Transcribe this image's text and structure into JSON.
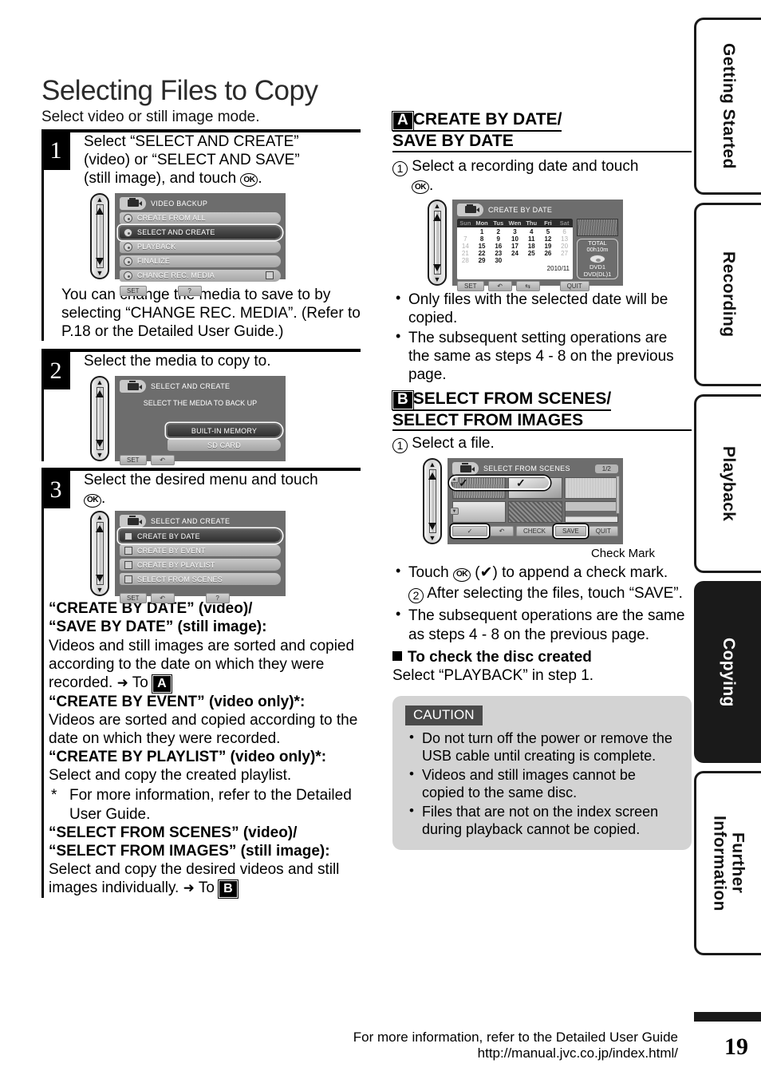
{
  "page": {
    "title": "Selecting Files to Copy",
    "subtitle": "Select video or still image mode.",
    "number": "19"
  },
  "footer": {
    "line1": "For more information, refer to the Detailed User Guide",
    "line2": "http://manual.jvc.co.jp/index.html/"
  },
  "side_tabs": [
    {
      "label": "Getting Started",
      "active": false
    },
    {
      "label": "Recording",
      "active": false
    },
    {
      "label": "Playback",
      "active": false
    },
    {
      "label": "Copying",
      "active": true
    },
    {
      "label": "Further\nInformation",
      "active": false
    }
  ],
  "steps": [
    {
      "number": "1",
      "text_a": "Select “SELECT AND CREATE”",
      "text_b": "(video) or “SELECT AND SAVE”",
      "text_c": "(still image), and touch ",
      "ok": "OK",
      "text_d": ".",
      "note": "You can change the media to save to by selecting “CHANGE REC. MEDIA”. (Refer to P.18 or the Detailed User Guide.)"
    },
    {
      "number": "2",
      "text_a": "Select the media to copy to."
    },
    {
      "number": "3",
      "text_a": "Select the desired menu and touch ",
      "ok": "OK",
      "text_d": "."
    }
  ],
  "screen_step1": {
    "title": "VIDEO BACKUP",
    "rows": [
      {
        "label": "CREATE FROM ALL",
        "icon": "disc-icon",
        "selected": false
      },
      {
        "label": "SELECT AND CREATE",
        "icon": "disc-icon",
        "selected": true
      },
      {
        "label": "PLAYBACK",
        "icon": "disc-icon",
        "selected": false
      },
      {
        "label": "FINALIZE",
        "icon": "disc-icon",
        "selected": false
      },
      {
        "label": "CHANGE REC. MEDIA",
        "icon": "disc-icon",
        "selected": false
      }
    ],
    "buttons": [
      {
        "label": "SET"
      },
      {
        "label": "?"
      }
    ]
  },
  "screen_step2": {
    "title": "SELECT AND CREATE",
    "prompt": "SELECT THE MEDIA TO BACK UP",
    "options": [
      {
        "label": "BUILT-IN MEMORY",
        "selected": true
      },
      {
        "label": "SD CARD",
        "selected": false
      }
    ],
    "buttons": [
      {
        "label": "SET"
      },
      {
        "label": "back-arrow"
      }
    ]
  },
  "screen_step3": {
    "title": "SELECT AND CREATE",
    "rows": [
      {
        "label": "CREATE BY DATE",
        "selected": true
      },
      {
        "label": "CREATE BY EVENT",
        "selected": false
      },
      {
        "label": "CREATE BY PLAYLIST",
        "selected": false
      },
      {
        "label": "SELECT FROM SCENES",
        "selected": false
      }
    ],
    "buttons": [
      {
        "label": "SET"
      },
      {
        "label": "back-arrow"
      },
      {
        "label": "?"
      }
    ]
  },
  "menu_descriptions": [
    {
      "heading_a": "“CREATE BY DATE” (video)/",
      "heading_b": "“SAVE BY DATE” (still image):",
      "body": "Videos and still images are sorted and copied according to the date on which they were recorded.",
      "ref_to": "To",
      "ref_badge": "A"
    },
    {
      "heading_a": "“CREATE BY EVENT” (video only)*:",
      "body": "Videos are sorted and copied according to the date on which they were recorded."
    },
    {
      "heading_a": "“CREATE BY PLAYLIST” (video only)*:",
      "body": "Select and copy the created playlist."
    }
  ],
  "footnote": {
    "marker": "*",
    "text": "For more information, refer to the Detailed User Guide."
  },
  "menu_descriptions_2": {
    "heading_a": "“SELECT FROM SCENES” (video)/",
    "heading_b": "“SELECT FROM IMAGES” (still image):",
    "body": "Select and copy the desired videos and still images individually.",
    "ref_to": "To",
    "ref_badge": "B"
  },
  "section_a": {
    "badge": "A",
    "heading_1": "CREATE BY DATE/",
    "heading_2": "SAVE BY DATE",
    "step1_num": "1",
    "step1_text_a": "Select a recording date and touch",
    "step1_ok": "OK",
    "step1_text_b": ".",
    "bullets": [
      "Only files with the selected date will be copied.",
      "The subsequent setting operations are the same as steps 4 - 8 on the previous page."
    ]
  },
  "screen_calendar": {
    "title": "CREATE BY DATE",
    "dow": [
      "Sun",
      "Mon",
      "Tus",
      "Wen",
      "Thu",
      "Fri",
      "Sat"
    ],
    "weeks": [
      [
        "",
        "1",
        "2",
        "3",
        "4",
        "5",
        "6"
      ],
      [
        "7",
        "8",
        "9",
        "10",
        "11",
        "12",
        "13"
      ],
      [
        "14",
        "15",
        "16",
        "17",
        "18",
        "19",
        "20"
      ],
      [
        "21",
        "22",
        "23",
        "24",
        "25",
        "26",
        "27"
      ],
      [
        "28",
        "29",
        "30",
        "",
        "",
        "",
        ""
      ]
    ],
    "dim_cells": [
      "6",
      "13",
      "20",
      "27",
      "7",
      "14",
      "21",
      "28",
      "1",
      "8",
      "15"
    ],
    "year_month": "2010/11",
    "total_label": "TOTAL",
    "total_time": "00h10m",
    "disc_label_1": "DVD1",
    "disc_label_2": "DVD(DL)1",
    "buttons": [
      {
        "label": "SET"
      },
      {
        "label": "back-arrow"
      },
      {
        "label": "media-switch"
      },
      {
        "label": "QUIT"
      }
    ]
  },
  "section_b": {
    "badge": "B",
    "heading_1": "SELECT FROM SCENES/",
    "heading_2": "SELECT FROM IMAGES",
    "step1_num": "1",
    "step1_text": "Select a file.",
    "check_mark_caption": "Check Mark",
    "bullet_touch_a": "Touch ",
    "bullet_touch_ok": "OK",
    "bullet_touch_b": " (✔) to append a check mark.",
    "step2_num": "2",
    "step2_text": "After selecting the files, touch “SAVE”.",
    "bullet_subsequent": "The subsequent operations are the same as steps 4 - 8 on the previous page.",
    "check_disc_heading": "To check the disc created",
    "check_disc_body": "Select “PLAYBACK” in step 1."
  },
  "screen_scenes": {
    "title": "SELECT FROM SCENES",
    "page_indicator": "1/2",
    "buttons": [
      {
        "label": "check-mark"
      },
      {
        "label": "back-arrow"
      },
      {
        "label": "CHECK"
      },
      {
        "label": "SAVE"
      },
      {
        "label": "QUIT"
      }
    ]
  },
  "caution": {
    "tag": "CAUTION",
    "items": [
      "Do not turn off the power or remove the USB cable until creating is complete.",
      "Videos and still images cannot be copied to the same disc.",
      "Files that are not on the index screen during playback cannot be copied."
    ]
  }
}
